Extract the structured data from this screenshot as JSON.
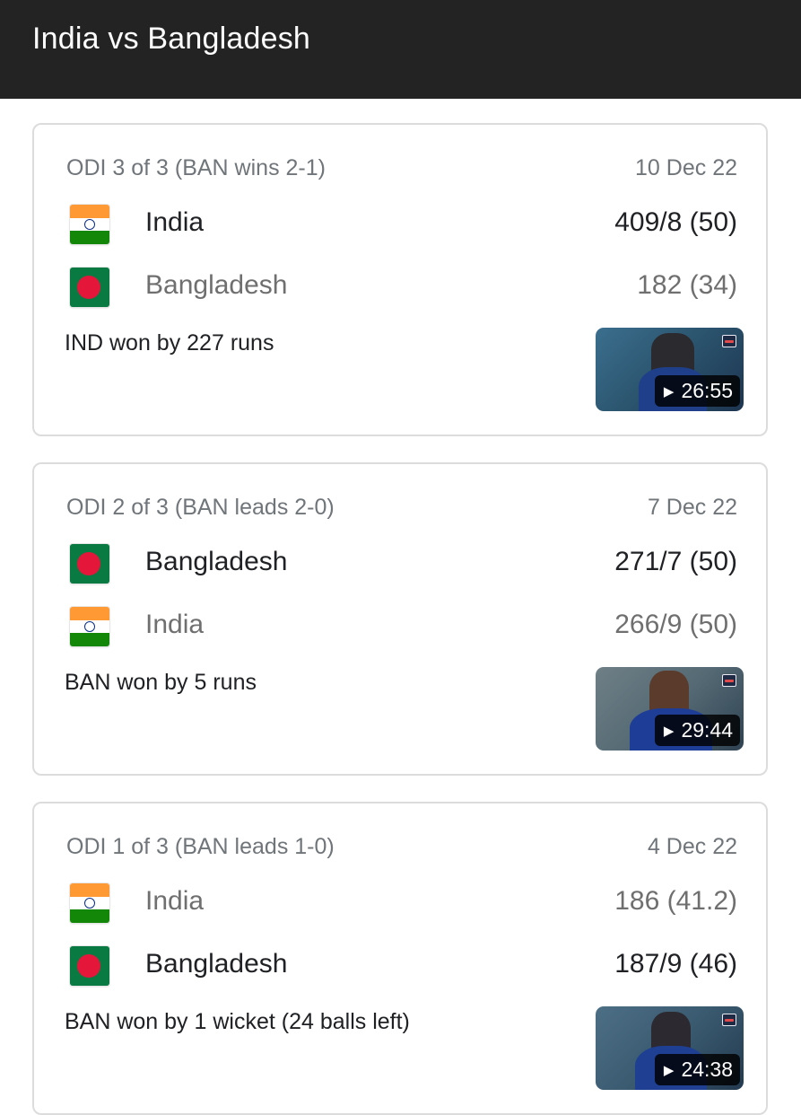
{
  "header": {
    "title": "India vs Bangladesh"
  },
  "matches": [
    {
      "series_status": "ODI 3 of 3 (BAN wins 2-1)",
      "date": "10 Dec 22",
      "teams": [
        {
          "name": "India",
          "score": "409/8 (50)",
          "flag": "india-flag",
          "winner": true
        },
        {
          "name": "Bangladesh",
          "score": "182 (34)",
          "flag": "bangladesh-flag",
          "winner": false
        }
      ],
      "result": "IND won by 227 runs",
      "video": {
        "duration": "26:55",
        "play_icon": "▶"
      }
    },
    {
      "series_status": "ODI 2 of 3 (BAN leads 2-0)",
      "date": "7 Dec 22",
      "teams": [
        {
          "name": "Bangladesh",
          "score": "271/7 (50)",
          "flag": "bangladesh-flag",
          "winner": true
        },
        {
          "name": "India",
          "score": "266/9 (50)",
          "flag": "india-flag",
          "winner": false
        }
      ],
      "result": "BAN won by 5 runs",
      "video": {
        "duration": "29:44",
        "play_icon": "▶"
      }
    },
    {
      "series_status": "ODI 1 of 3 (BAN leads 1-0)",
      "date": "4 Dec 22",
      "teams": [
        {
          "name": "India",
          "score": "186 (41.2)",
          "flag": "india-flag",
          "winner": false
        },
        {
          "name": "Bangladesh",
          "score": "187/9 (46)",
          "flag": "bangladesh-flag",
          "winner": true
        }
      ],
      "result": "BAN won by 1 wicket (24 balls left)",
      "video": {
        "duration": "24:38",
        "play_icon": "▶"
      }
    }
  ],
  "colors": {
    "header_bg": "#232323",
    "india_saffron": "#ff9933",
    "india_green": "#138808",
    "bangladesh_green": "#0a7a43",
    "bangladesh_red": "#e4163a",
    "muted_text": "#70757a"
  }
}
